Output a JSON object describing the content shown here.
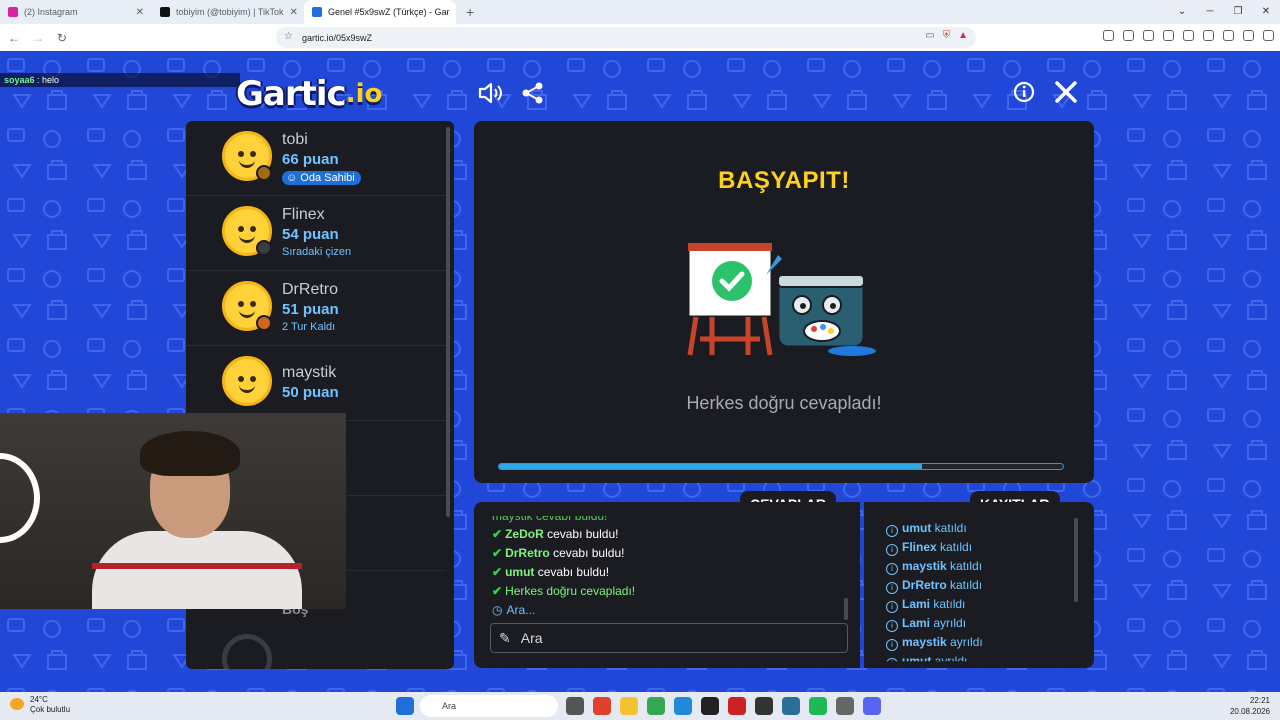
{
  "browser": {
    "tabs": [
      {
        "title": "(2) Instagram",
        "color": "#d6249f"
      },
      {
        "title": "tobiyim (@tobiyim) | TikTok",
        "color": "#111111"
      },
      {
        "title": "Genel #5x9swZ (Türkçe) - Gar",
        "color": "#1f6fd8"
      }
    ],
    "new_tab": "+",
    "url": "gartic.io/05x9swZ"
  },
  "overlay_chat": {
    "user": "soyaa6",
    "message": " : helo"
  },
  "logo": {
    "text": "Gartic",
    "ext": ".io"
  },
  "players": [
    {
      "name": "tobi",
      "score": "66 puan",
      "badge": "Oda Sahibi",
      "dot": "#a36a10"
    },
    {
      "name": "Flinex",
      "score": "54 puan",
      "badge": "Sıradaki çizen",
      "dot": "#3a3c45"
    },
    {
      "name": "DrRetro",
      "score": "51 puan",
      "badge": "2 Tur Kaldı",
      "dot": "#d4641a"
    },
    {
      "name": "maystik",
      "score": "50 puan",
      "badge": "",
      "dot": ""
    }
  ],
  "empty_slot_label": "Boş",
  "round": {
    "title": "BAŞYAPIT!",
    "status": "Herkes doğru cevapladı!",
    "progress": 0.75
  },
  "answers": {
    "tab_label": "CEVAPLAR",
    "cut_top": "maystik cevabı buldu!",
    "lines": [
      {
        "who": "ZeDoR",
        "text": " cevabı buldu!"
      },
      {
        "who": "DrRetro",
        "text": " cevabı buldu!"
      },
      {
        "who": "umut",
        "text": " cevabı buldu!"
      }
    ],
    "all_correct": "Herkes doğru cevapladı!",
    "more": "Ara...",
    "input_placeholder": "Ara"
  },
  "logs": {
    "tab_label": "KAYITLAR",
    "lines": [
      {
        "who": "umut",
        "action": " katıldı"
      },
      {
        "who": "Flinex",
        "action": " katıldı"
      },
      {
        "who": "maystik",
        "action": " katıldı"
      },
      {
        "who": "DrRetro",
        "action": " katıldı"
      },
      {
        "who": "Lami",
        "action": " katıldı"
      },
      {
        "who": "Lami",
        "action": " ayrıldı"
      },
      {
        "who": "maystik",
        "action": " ayrıldı"
      },
      {
        "who": "umut",
        "action": " ayrıldı"
      }
    ]
  },
  "taskbar": {
    "temp": "24°C",
    "weather": "Çok bulutlu",
    "search": "Ara",
    "time": "22:21",
    "date": "20.08.2026"
  },
  "colors": {
    "accent_yellow": "#ffd11a",
    "accent_blue": "#6fc3ff",
    "success_green": "#33d64a",
    "bg_blue": "#2147d8"
  }
}
